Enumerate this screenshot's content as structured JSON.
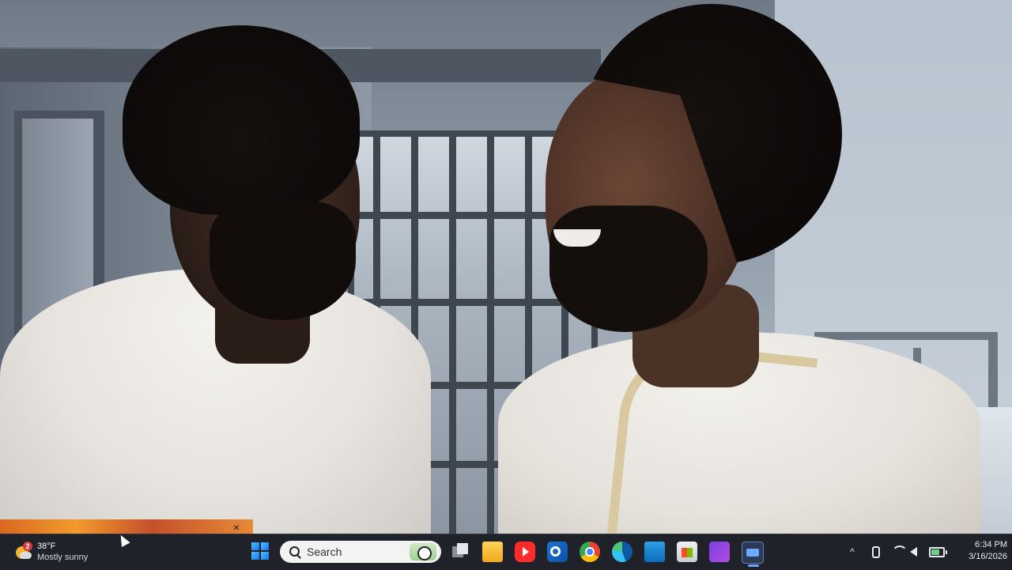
{
  "weather": {
    "temperature": "38°F",
    "condition": "Mostly sunny",
    "badge_count": "2",
    "icon": "partly-sunny-icon"
  },
  "widget_notification": {
    "close_glyph": "×"
  },
  "taskbar": {
    "search_label": "Search",
    "apps": [
      {
        "name": "task-view",
        "icon": "task-view-icon"
      },
      {
        "name": "file-explorer",
        "icon": "folder-icon"
      },
      {
        "name": "youtube",
        "icon": "youtube-icon"
      },
      {
        "name": "outlook",
        "icon": "outlook-icon"
      },
      {
        "name": "chrome",
        "icon": "chrome-icon"
      },
      {
        "name": "edge",
        "icon": "edge-icon"
      },
      {
        "name": "notes",
        "icon": "notes-icon"
      },
      {
        "name": "microsoft-store",
        "icon": "store-icon"
      },
      {
        "name": "clipchamp",
        "icon": "clipchamp-icon"
      },
      {
        "name": "active-app",
        "icon": "video-app-icon"
      }
    ]
  },
  "tray": {
    "chevron": "^",
    "battery_level": 0.7
  },
  "clock": {
    "time": "6:34 PM",
    "date": "3/16/2026"
  },
  "colors": {
    "taskbar_bg": "#1f2228",
    "accent": "#6ea8ff"
  }
}
